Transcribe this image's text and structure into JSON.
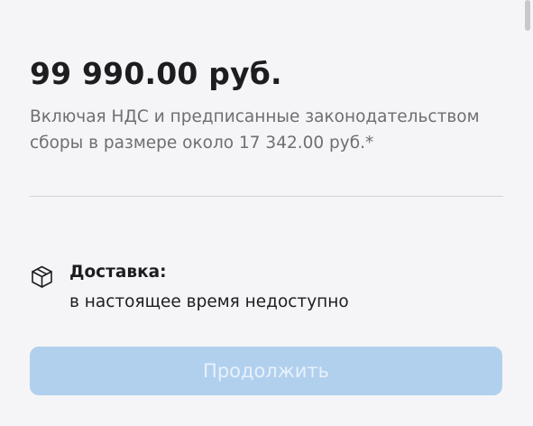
{
  "price": {
    "amount": "99 990.00 руб.",
    "vat_note": "Включая НДС и предписанные законодательством сборы в размере около 17 342.00 руб.*"
  },
  "delivery": {
    "icon": "box-icon",
    "title": "Доставка:",
    "status": "в настоящее время недоступно"
  },
  "actions": {
    "continue_label": "Продолжить",
    "continue_enabled": false
  },
  "colors": {
    "background": "#f5f5f7",
    "text_primary": "#1d1d1f",
    "text_secondary": "#6e6e73",
    "button_disabled_bg": "#b1d0ee",
    "button_disabled_text": "#e8f1fb"
  }
}
